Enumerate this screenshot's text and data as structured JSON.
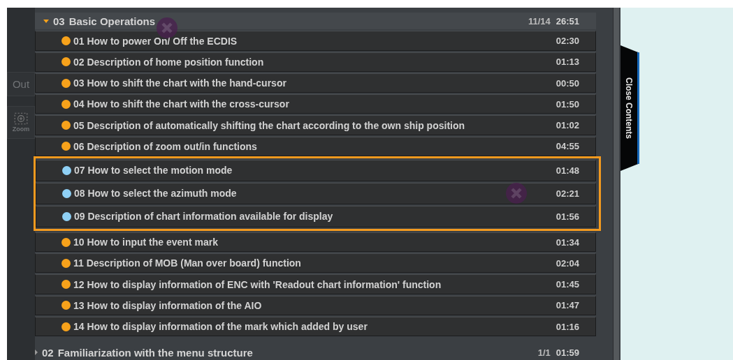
{
  "toolbar": {
    "buttons": [
      {
        "label": "Out",
        "kind": "text"
      },
      {
        "label": "Zoom",
        "kind": "icon"
      }
    ]
  },
  "groups": [
    {
      "number": "03",
      "title": "Basic Operations",
      "expanded": true,
      "progress": "11/14",
      "duration": "26:51",
      "items": [
        {
          "title": "01 How to power On/ Off the ECDIS",
          "duration": "02:30",
          "color": "#f7a21b",
          "highlighted": false
        },
        {
          "title": "02 Description of home position function",
          "duration": "01:13",
          "color": "#f7a21b",
          "highlighted": false
        },
        {
          "title": "03 How to shift the chart with the hand-cursor",
          "duration": "00:50",
          "color": "#f7a21b",
          "highlighted": false
        },
        {
          "title": "04 How to shift the chart with the cross-cursor",
          "duration": "01:50",
          "color": "#f7a21b",
          "highlighted": false
        },
        {
          "title": "05 Description of automatically shifting the chart according to the own ship position",
          "duration": "01:02",
          "color": "#f7a21b",
          "highlighted": false
        },
        {
          "title": "06 Description of zoom out/in functions",
          "duration": "04:55",
          "color": "#f7a21b",
          "highlighted": false
        },
        {
          "title": "07 How to select the motion mode",
          "duration": "01:48",
          "color": "#8fd0f5",
          "highlighted": true
        },
        {
          "title": "08 How to select the azimuth mode",
          "duration": "02:21",
          "color": "#8fd0f5",
          "highlighted": true
        },
        {
          "title": "09 Description of chart information available for display",
          "duration": "01:56",
          "color": "#8fd0f5",
          "highlighted": true
        },
        {
          "title": "10 How to input the event mark",
          "duration": "01:34",
          "color": "#f7a21b",
          "highlighted": false
        },
        {
          "title": "11 Description of MOB (Man over board) function",
          "duration": "02:04",
          "color": "#f7a21b",
          "highlighted": false
        },
        {
          "title": "12 How to display information of ENC with 'Readout chart information' function",
          "duration": "01:45",
          "color": "#f7a21b",
          "highlighted": false
        },
        {
          "title": "13 How to display information of the AIO",
          "duration": "01:47",
          "color": "#f7a21b",
          "highlighted": false
        },
        {
          "title": "14 How to display information of the mark which added by user",
          "duration": "01:16",
          "color": "#f7a21b",
          "highlighted": false
        }
      ]
    },
    {
      "number": "02",
      "title": "Familiarization with the menu structure",
      "expanded": false,
      "progress": "1/1",
      "duration": "01:59"
    }
  ],
  "side_tab": {
    "label": "Close Contents"
  }
}
